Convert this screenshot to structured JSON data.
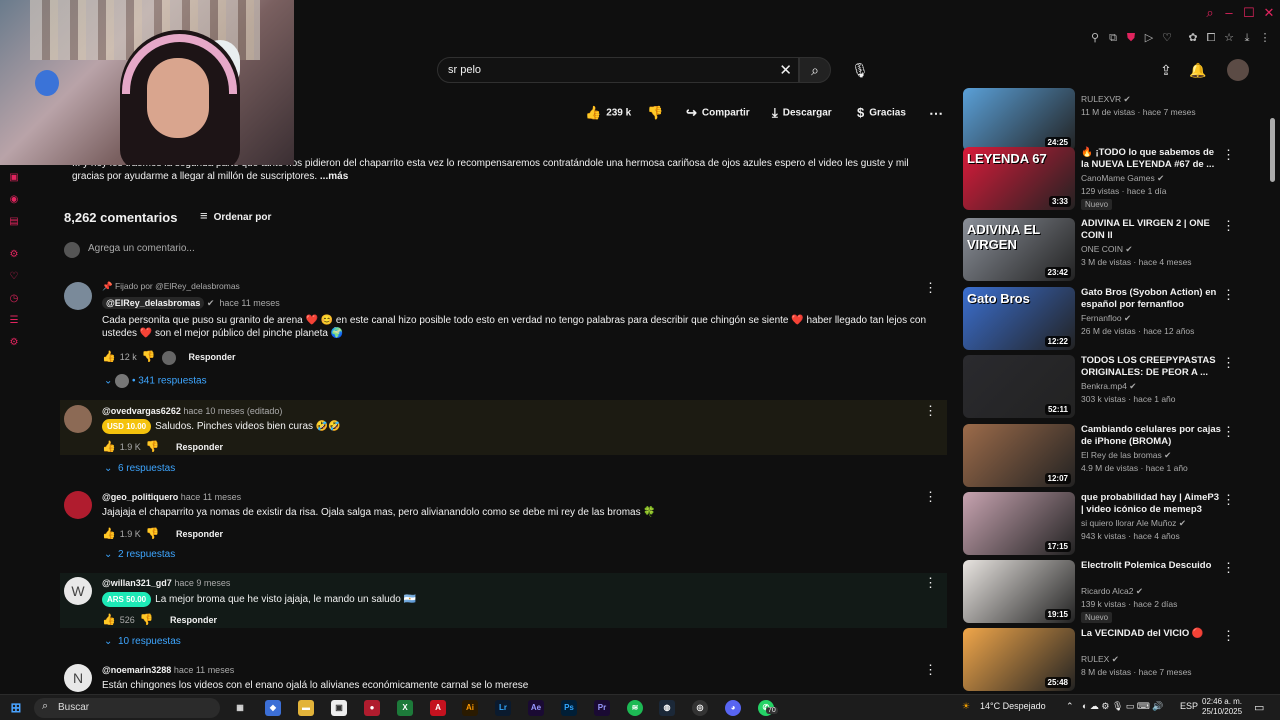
{
  "browser": {
    "window_controls": [
      "search-icon",
      "minimize-icon",
      "maximize-icon",
      "close-icon"
    ],
    "extensions": [
      "pin-icon",
      "screenshot-icon",
      "shield-icon",
      "play-icon",
      "heart-icon",
      "extension-icon",
      "puzzle-icon",
      "download-icon",
      "sidebar-icon",
      "menu-icon"
    ]
  },
  "header": {
    "search_value": "sr pelo",
    "create_icon": "upload-icon",
    "notifications_icon": "bell-icon"
  },
  "actions": {
    "likes": "239 k",
    "share": "Compartir",
    "download": "Descargar",
    "thanks": "Gracias"
  },
  "description": {
    "text": "... y hoy les traemos la segunda parte que tanto nos pidieron del chaparrito esta vez lo recompensaremos contratándole una hermosa cariñosa de ojos azules espero el video les guste y mil gracias por ayudarme a llegar al millón de suscriptores.",
    "more": " ...más"
  },
  "comments_header": {
    "count": "8,262 comentarios",
    "sort": "Ordenar por",
    "add_placeholder": "Agrega un comentario..."
  },
  "comments": [
    {
      "pinned": "Fijado por @ElRey_delasbromas",
      "author": "@ElRey_delasbromas",
      "time": "hace 11 meses",
      "text": "Cada personita que puso su granito de arena ❤️ 😊 en este canal hizo posible todo esto en verdad no tengo palabras para describir que chingón se siente ❤️ haber llegado tan lejos con ustedes ❤️ son el mejor público del pinche planeta 🌍",
      "likes": "12 k",
      "reply": "Responder",
      "replies": "341 respuestas"
    },
    {
      "author": "@ovedvargas6262",
      "time": "hace 10 meses (editado)",
      "badge": "USD 10.00",
      "badge_color": "#f4c20d",
      "text": "Saludos. Pinches videos bien curas 🤣🤣",
      "likes": "1.9 K",
      "reply": "Responder",
      "replies": "6 respuestas"
    },
    {
      "author": "@geo_politiquero",
      "time": "hace 11 meses",
      "text": "Jajajaja el chaparrito ya nomas de existir da risa. Ojala salga mas, pero alivianandolo como se debe mi rey de las bromas 🍀",
      "likes": "1.9 K",
      "reply": "Responder",
      "replies": "2 respuestas"
    },
    {
      "author": "@willan321_gd7",
      "time": "hace 9 meses",
      "avatar_letter": "W",
      "badge": "ARS 50.00",
      "badge_color": "#1de9b6",
      "text": "La mejor broma que he visto jajaja, le mando un saludo 🇦🇷",
      "likes": "526",
      "reply": "Responder",
      "replies": "10 respuestas"
    },
    {
      "author": "@noemarin3288",
      "time": "hace 11 meses",
      "avatar_letter": "N",
      "text": "Están chingones los videos con el enano ojalá lo alivianes económicamente carnal se lo merese"
    }
  ],
  "related": [
    {
      "title": "",
      "channel": "RULEXVR",
      "stats": "11 M de vistas · hace 7 meses",
      "duration": "24:25",
      "thumb_color": "#5aa0d8"
    },
    {
      "title": "🔥 ¡TODO lo que sabemos de la NUEVA LEYENDA #67 de ...",
      "channel": "CanoMame Games",
      "stats": "129 vistas · hace 1 día",
      "duration": "3:33",
      "badge": "Nuevo",
      "thumb_text": "LEYENDA 67",
      "thumb_color": "#d81b3a"
    },
    {
      "title": "ADIVINA EL VIRGEN 2 | ONE COIN ll",
      "channel": "ONE COIN",
      "stats": "3 M de vistas · hace 4 meses",
      "duration": "23:42",
      "thumb_text": "ADIVINA EL VIRGEN",
      "thumb_color": "#8a8f98"
    },
    {
      "title": "Gato Bros (Syobon Action) en español por fernanfloo",
      "channel": "Fernanfloo",
      "stats": "26 M de vistas · hace 12 años",
      "duration": "12:22",
      "thumb_text": "Gato Bros",
      "thumb_color": "#3b6fd0"
    },
    {
      "title": "TODOS LOS CREEPYPASTAS ORIGINALES: DE PEOR A ...",
      "channel": "Benkra.mp4",
      "stats": "303 k vistas · hace 1 año",
      "duration": "52:11",
      "thumb_color": "#2a2a2e"
    },
    {
      "title": "Cambiando celulares por cajas de iPhone (BROMA)",
      "channel": "El Rey de las bromas",
      "stats": "4.9 M de vistas · hace 1 año",
      "duration": "12:07",
      "thumb_color": "#9c6b4a"
    },
    {
      "title": "que probabilidad hay | AimeP3 | video icónico de memep3",
      "channel": "si quiero llorar Ale Muñoz",
      "stats": "943 k vistas · hace 4 años",
      "duration": "17:15",
      "thumb_color": "#c7a3b0"
    },
    {
      "title": "Electrolit Polemica Descuido",
      "channel": "Ricardo Alca2",
      "stats": "139 k vistas · hace 2 días",
      "duration": "19:15",
      "badge": "Nuevo",
      "thumb_color": "#e8e4e0"
    },
    {
      "title": "La VECINDAD del VICIO 🔴",
      "channel": "RULEX",
      "stats": "8 M de vistas · hace 7 meses",
      "duration": "25:48",
      "thumb_color": "#f0a64a"
    }
  ],
  "taskbar": {
    "search": "Buscar",
    "weather": "14°C  Despejado",
    "lang": "ESP",
    "time": "02:46 a. m.",
    "date": "25/10/2025",
    "badge_count": "70"
  }
}
